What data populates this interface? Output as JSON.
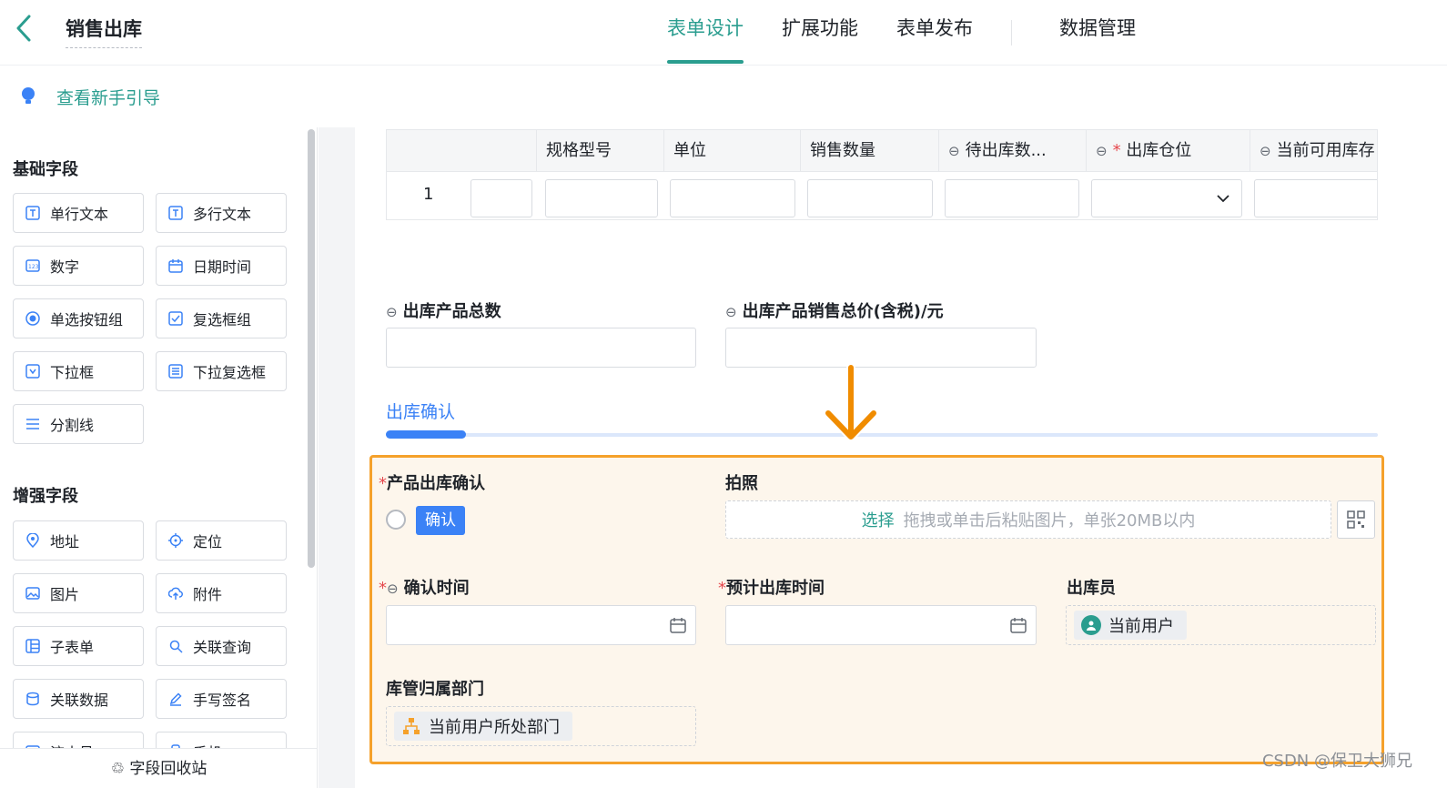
{
  "header": {
    "title": "销售出库",
    "tabs": [
      {
        "label": "表单设计",
        "active": true
      },
      {
        "label": "扩展功能",
        "active": false
      },
      {
        "label": "表单发布",
        "active": false
      },
      {
        "label": "数据管理",
        "active": false
      }
    ]
  },
  "guide": {
    "label": "查看新手引导"
  },
  "sidebar": {
    "basic_title": "基础字段",
    "basic_fields": [
      "单行文本",
      "多行文本",
      "数字",
      "日期时间",
      "单选按钮组",
      "复选框组",
      "下拉框",
      "下拉复选框",
      "分割线"
    ],
    "enhanced_title": "增强字段",
    "enhanced_fields": [
      "地址",
      "定位",
      "图片",
      "附件",
      "子表单",
      "关联查询",
      "关联数据",
      "手写签名",
      "流水号",
      "手机"
    ],
    "recycle_label": "字段回收站"
  },
  "table": {
    "columns": [
      "规格型号",
      "单位",
      "销售数量",
      "待出库数...",
      "出库仓位",
      "当前可用库存"
    ],
    "row_number": "1"
  },
  "fields": {
    "total_count_label": "出库产品总数",
    "total_price_label": "出库产品销售总价(含税)/元",
    "section_title": "出库确认",
    "product_confirm_label": "产品出库确认",
    "confirm_tag": "确认",
    "photo_label": "拍照",
    "photo_select": "选择",
    "photo_hint": "拖拽或单击后粘贴图片，单张20MB以内",
    "confirm_time_label": "确认时间",
    "expected_time_label": "预计出库时间",
    "operator_label": "出库员",
    "operator_value": "当前用户",
    "dept_label": "库管归属部门",
    "dept_value": "当前用户所处部门"
  },
  "watermark": "CSDN @保卫大狮兄",
  "colors": {
    "accent": "#2a9d8f",
    "blue": "#3b82f6",
    "highlight_border": "#f5a12b",
    "arrow": "#f08c00"
  }
}
